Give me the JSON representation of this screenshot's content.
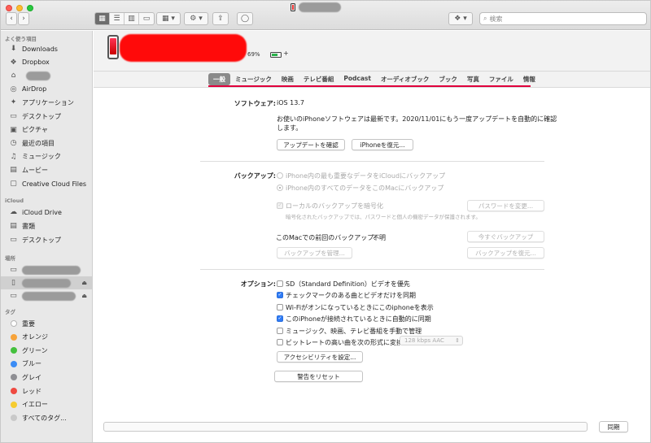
{
  "toolbar": {
    "nav_back": "‹",
    "nav_forward": "›",
    "search_placeholder": "検索"
  },
  "sidebar": {
    "favorites_header": "よく使う項目",
    "favorites": [
      {
        "label": "Downloads",
        "icon": "download-icon",
        "glyph": "⬇"
      },
      {
        "label": "Dropbox",
        "icon": "dropbox-icon",
        "glyph": "❖"
      },
      {
        "label": "",
        "icon": "home-icon",
        "glyph": "⌂"
      },
      {
        "label": "AirDrop",
        "icon": "airdrop-icon",
        "glyph": "◎"
      },
      {
        "label": "アプリケーション",
        "icon": "applications-icon",
        "glyph": "✦"
      },
      {
        "label": "デスクトップ",
        "icon": "desktop-icon",
        "glyph": "▭"
      },
      {
        "label": "ピクチャ",
        "icon": "pictures-icon",
        "glyph": "▣"
      },
      {
        "label": "最近の項目",
        "icon": "recents-icon",
        "glyph": "◷"
      },
      {
        "label": "ミュージック",
        "icon": "music-icon",
        "glyph": "♫"
      },
      {
        "label": "ムービー",
        "icon": "movies-icon",
        "glyph": "▤"
      },
      {
        "label": "Creative Cloud Files",
        "icon": "creative-cloud-icon",
        "glyph": "▢"
      }
    ],
    "icloud_header": "iCloud",
    "icloud": [
      {
        "label": "iCloud Drive",
        "icon": "cloud-icon",
        "glyph": "☁"
      },
      {
        "label": "書類",
        "icon": "documents-icon",
        "glyph": "▤"
      },
      {
        "label": "デスクトップ",
        "icon": "desktop-icon",
        "glyph": "▭"
      }
    ],
    "locations_header": "場所",
    "eject_glyph": "⏏",
    "tags_header": "タグ",
    "tags": [
      {
        "label": "重要",
        "color": "#ffffff"
      },
      {
        "label": "オレンジ",
        "color": "#f7a33a"
      },
      {
        "label": "グリーン",
        "color": "#44c03d"
      },
      {
        "label": "ブルー",
        "color": "#3b8cf5"
      },
      {
        "label": "グレイ",
        "color": "#8e8e93"
      },
      {
        "label": "レッド",
        "color": "#ef4a41"
      },
      {
        "label": "イエロー",
        "color": "#f6cc30"
      },
      {
        "label": "すべてのタグ...",
        "color": "#c9c9c9"
      }
    ]
  },
  "device": {
    "battery_percent": 69,
    "battery_text": "69%",
    "battery_color": "#2bb24c",
    "charging_glyph": "+"
  },
  "tabs": [
    "一般",
    "ミュージック",
    "映画",
    "テレビ番組",
    "Podcast",
    "オーディオブック",
    "ブック",
    "写真",
    "ファイル",
    "情報"
  ],
  "software": {
    "label": "ソフトウェア:",
    "version": "iOS 13.7",
    "status_line1": "お使いのiPhoneソフトウェアは最新です。2020/11/01にもう一度アップデートを自動的に確認",
    "status_line2": "します。",
    "check_update_button": "アップデートを確認",
    "restore_button": "iPhoneを復元..."
  },
  "backup": {
    "label": "バックアップ:",
    "option_icloud": "iPhone内の最も重要なデータをiCloudにバックアップ",
    "option_mac": "iPhone内のすべてのデータをこのMacにバックアップ",
    "encrypt_label": "ローカルのバックアップを暗号化",
    "encrypt_note": "暗号化されたバックアップでは、パスワードと個人の機密データが保護されます。",
    "change_password_button": "パスワードを変更...",
    "last_backup_label": "このMacでの前回のバックアップ:",
    "last_backup_value": "不明",
    "backup_now_button": "今すぐバックアップ",
    "manage_button": "バックアップを管理...",
    "restore_backup_button": "バックアップを復元..."
  },
  "options": {
    "label": "オプション:",
    "items": [
      {
        "label": "SD（Standard Definition）ビデオを優先",
        "checked": false
      },
      {
        "label": "チェックマークのある曲とビデオだけを同期",
        "checked": true
      },
      {
        "label": "Wi-Fiがオンになっているときにこのiphoneを表示",
        "checked": false
      },
      {
        "label": "このiPhoneが接続されているときに自動的に同期",
        "checked": true
      },
      {
        "label": "ミュージック、映画、テレビ番組を手動で管理",
        "checked": false
      },
      {
        "label": "ビットレートの高い曲を次の形式に変換:",
        "checked": false
      }
    ],
    "bitrate_value": "128 kbps AAC",
    "accessibility_button": "アクセシビリティを設定...",
    "reset_warnings_button": "警告をリセット"
  },
  "footer": {
    "sync_button": "同期"
  }
}
